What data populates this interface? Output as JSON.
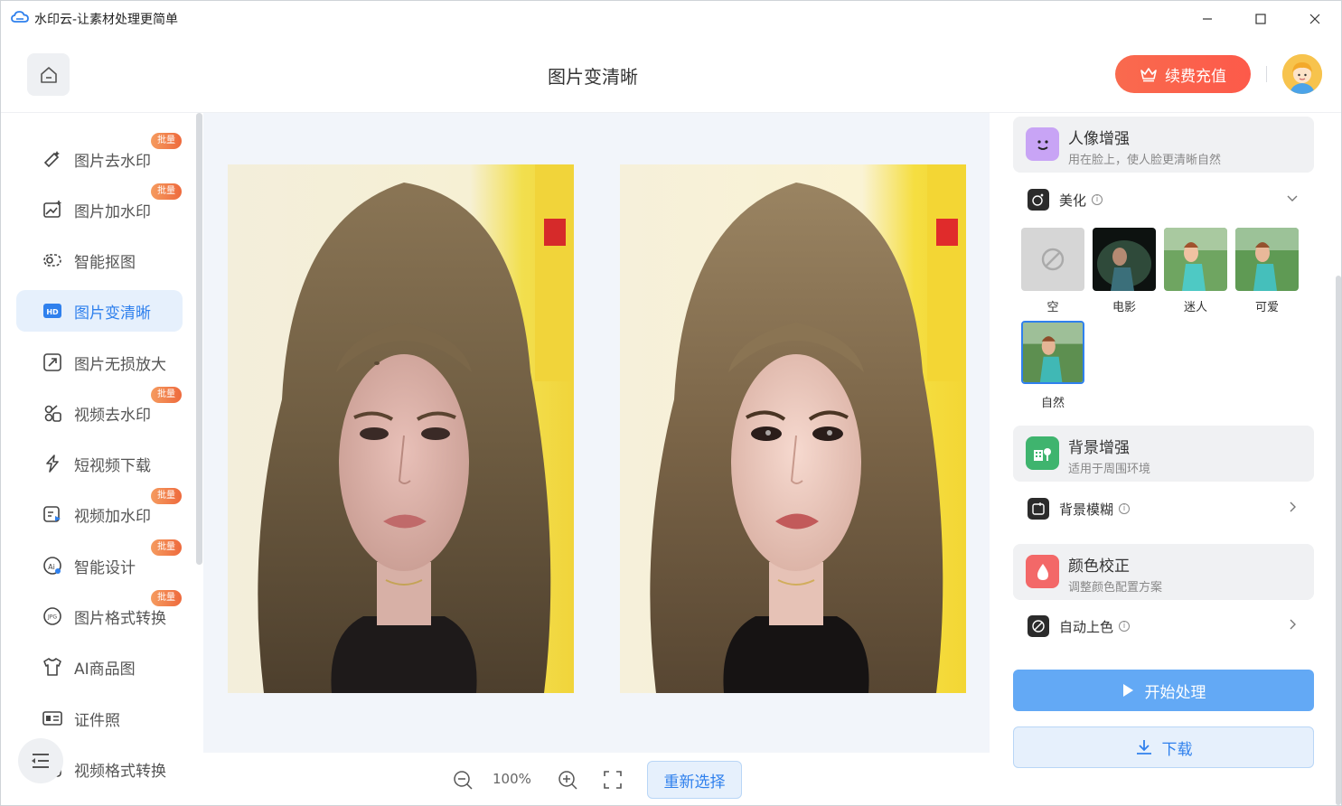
{
  "window": {
    "title": "水印云-让素材处理更简单"
  },
  "header": {
    "page_title": "图片变清晰",
    "vip_label": "续费充值"
  },
  "sidebar": {
    "items": [
      {
        "label": "图片去水印",
        "icon": "wand-icon",
        "badge": "批量"
      },
      {
        "label": "图片加水印",
        "icon": "image-watermark-icon",
        "badge": "批量"
      },
      {
        "label": "智能抠图",
        "icon": "cutout-icon",
        "badge": ""
      },
      {
        "label": "图片变清晰",
        "icon": "hd-icon",
        "badge": "",
        "active": true
      },
      {
        "label": "图片无损放大",
        "icon": "enlarge-icon",
        "badge": ""
      },
      {
        "label": "视频去水印",
        "icon": "video-erase-icon",
        "badge": "批量"
      },
      {
        "label": "短视频下载",
        "icon": "download-link-icon",
        "badge": ""
      },
      {
        "label": "视频加水印",
        "icon": "video-watermark-icon",
        "badge": "批量"
      },
      {
        "label": "智能设计",
        "icon": "design-icon",
        "badge": "批量"
      },
      {
        "label": "图片格式转换",
        "icon": "jpg-icon",
        "badge": "批量"
      },
      {
        "label": "AI商品图",
        "icon": "shirt-icon",
        "badge": ""
      },
      {
        "label": "证件照",
        "icon": "id-card-icon",
        "badge": ""
      },
      {
        "label": "视频格式转换",
        "icon": "video-format-icon",
        "badge": ""
      }
    ]
  },
  "toolbar": {
    "zoom": "100%",
    "reselect_label": "重新选择"
  },
  "panel": {
    "portrait": {
      "title": "人像增强",
      "subtitle": "用在脸上，使人脸更清晰自然"
    },
    "beautify": {
      "label": "美化",
      "info": "i"
    },
    "presets": [
      {
        "label": "空"
      },
      {
        "label": "电影"
      },
      {
        "label": "迷人"
      },
      {
        "label": "可爱"
      },
      {
        "label": "自然",
        "selected": true
      }
    ],
    "background": {
      "title": "背景增强",
      "subtitle": "适用于周围环境"
    },
    "bg_blur": {
      "label": "背景模糊",
      "info": "i"
    },
    "color": {
      "title": "颜色校正",
      "subtitle": "调整颜色配置方案"
    },
    "auto_color": {
      "label": "自动上色",
      "info": "i"
    },
    "start_label": "开始处理",
    "download_label": "下载"
  },
  "colors": {
    "accent": "#2f80ed",
    "vip": "#fd5a4a",
    "badge": "#ee6a3d",
    "start": "#63a9f5"
  }
}
